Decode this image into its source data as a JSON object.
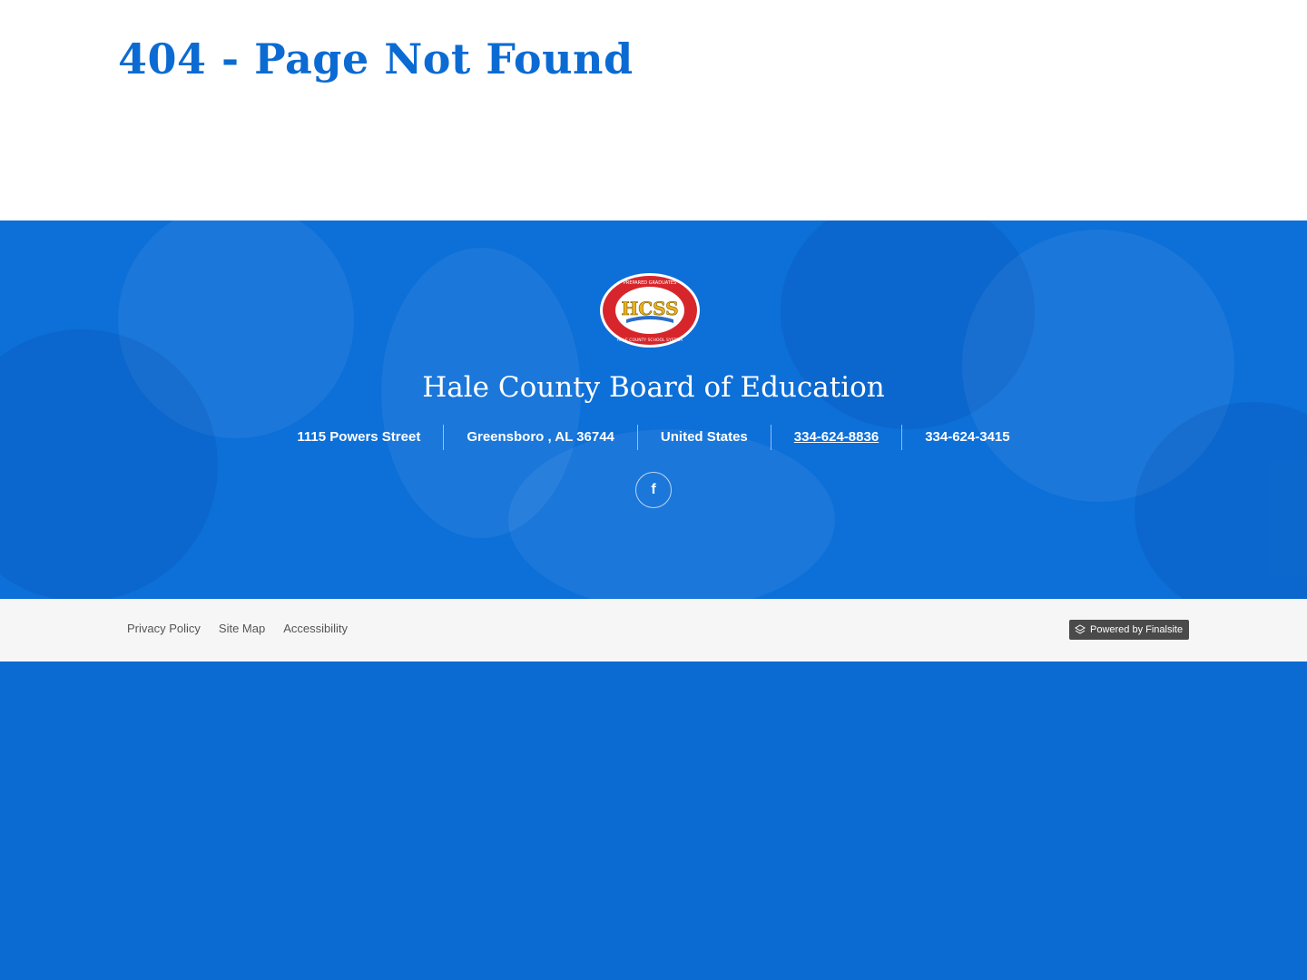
{
  "page": {
    "title": "404 - Page Not Found"
  },
  "footer": {
    "logo": {
      "top_text": "PREPARED GRADUATES",
      "main_text": "HCSS",
      "bottom_text": "HALE COUNTY SCHOOL SYSTEM"
    },
    "org_name": "Hale County Board of Education",
    "contact": {
      "street": "1115 Powers Street",
      "city_state_zip": "Greensboro , AL  36744",
      "country": "United States",
      "phone": "334-624-8836",
      "fax": "334-624-3415"
    },
    "social": {
      "facebook_glyph": "f"
    }
  },
  "bottom_bar": {
    "links": [
      "Privacy Policy",
      "Site Map",
      "Accessibility"
    ],
    "powered_by": "Powered by Finalsite"
  },
  "colors": {
    "brand_blue": "#0b6bd3",
    "white": "#ffffff",
    "bottom_bar_bg": "#f6f6f6",
    "powered_badge_bg": "#4a4a4a",
    "logo_red": "#d7262b",
    "logo_gold": "#e8b21c"
  }
}
